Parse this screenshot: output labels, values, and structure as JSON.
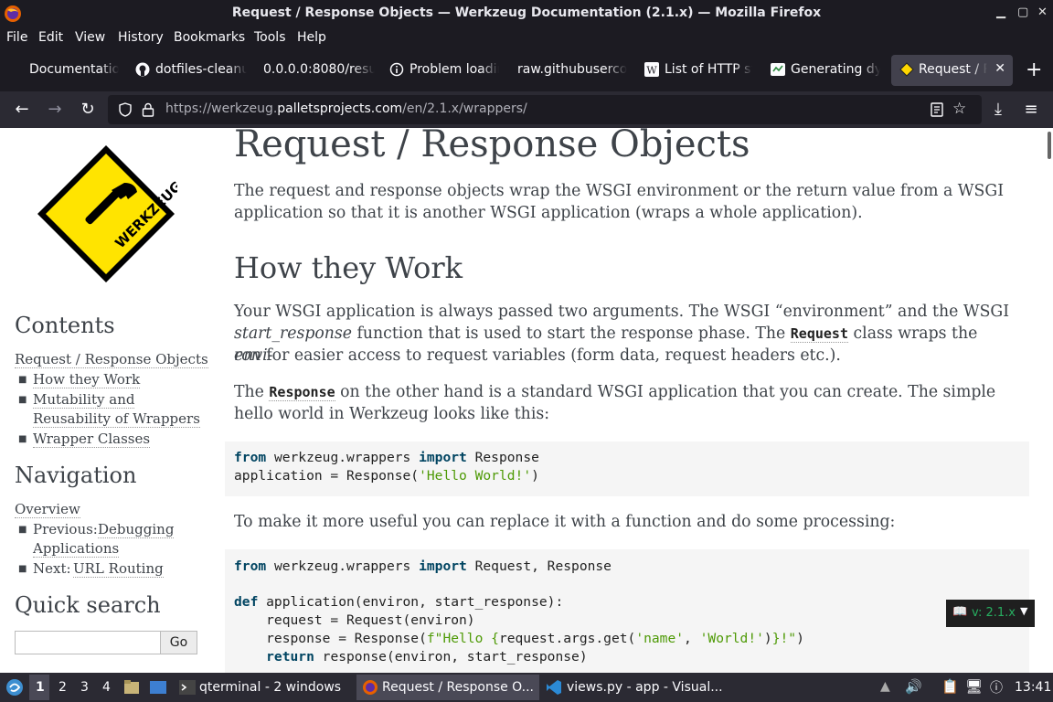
{
  "window": {
    "title": "Request / Response Objects — Werkzeug Documentation (2.1.x) — Mozilla Firefox"
  },
  "menu": [
    "File",
    "Edit",
    "View",
    "History",
    "Bookmarks",
    "Tools",
    "Help"
  ],
  "tabs": [
    {
      "label": "Documentation"
    },
    {
      "label": "dotfiles-cleanup"
    },
    {
      "label": "0.0.0.0:8080/resu"
    },
    {
      "label": "Problem loading"
    },
    {
      "label": "raw.githubuserco"
    },
    {
      "label": "List of HTTP st"
    },
    {
      "label": "Generating dy"
    },
    {
      "label": "Request / Re"
    }
  ],
  "url": {
    "prefix": "https://werkzeug.",
    "domain": "palletsprojects.com",
    "path": "/en/2.1.x/wrappers/"
  },
  "sidebar": {
    "contents_title": "Contents",
    "contents_top": "Request / Response Objects",
    "contents_items": [
      "How they Work",
      "Mutability and",
      "Reusability of Wrappers",
      "Wrapper Classes"
    ],
    "nav_title": "Navigation",
    "nav_overview": "Overview",
    "prev_label": "Previous:",
    "prev_link_1": "Debugging",
    "prev_link_2": "Applications",
    "next_label": "Next:",
    "next_link": "URL Routing",
    "search_title": "Quick search",
    "search_button": "Go"
  },
  "content": {
    "h1": "Request / Response Objects",
    "intro_1": "The request and response objects wrap the WSGI environment or the return value from a WSGI",
    "intro_2": "application so that it is another WSGI application (wraps a whole application).",
    "h2": "How they Work",
    "p2_1a": "Your WSGI application is always passed two arguments. The WSGI “environment” and the WSGI",
    "p2_2_start": "start_response",
    "p2_2_mid": " function that is used to start the response phase. The ",
    "p2_2_code": "Request",
    "p2_2_end": " class wraps the ",
    "p2_2_env": "envi-",
    "p2_3_env": "ron",
    "p2_3_end": " for easier access to request variables (form data, request headers etc.).",
    "p3_start": "The ",
    "p3_code": "Response",
    "p3_end": " on the other hand is a standard WSGI application that you can create. The simple",
    "p3_2": "hello world in Werkzeug looks like this:",
    "p4": "To make it more useful you can replace it with a function and do some processing:",
    "code1": {
      "l1_kw1": "from",
      "l1_mid": " werkzeug.wrappers ",
      "l1_kw2": "import",
      "l1_end": " Response",
      "l2_start": "application = Response(",
      "l2_str": "'Hello World!'",
      "l2_end": ")"
    },
    "code2": {
      "l1_kw1": "from",
      "l1_mid": " werkzeug.wrappers ",
      "l1_kw2": "import",
      "l1_end": " Request, Response",
      "l3_kw": "def",
      "l3_end": " application(environ, start_response):",
      "l4": "    request = Request(environ)",
      "l5_start": "    response = Response(",
      "l5_s1": "f\"Hello {",
      "l5_mid": "request.args.get(",
      "l5_s2": "'name'",
      "l5_c": ", ",
      "l5_s3": "'World!'",
      "l5_close": ")",
      "l5_s4": "}!\"",
      "l5_end": ")",
      "l6_kw": "    return",
      "l6_end": " response(environ, start_response)"
    },
    "version_badge": "v: 2.1.x"
  },
  "taskbar": {
    "workspaces": [
      "1",
      "2",
      "3",
      "4"
    ],
    "tasks": [
      "qterminal - 2 windows",
      "Request / Response O...",
      "views.py - app - Visual..."
    ],
    "clock": "13:41"
  }
}
